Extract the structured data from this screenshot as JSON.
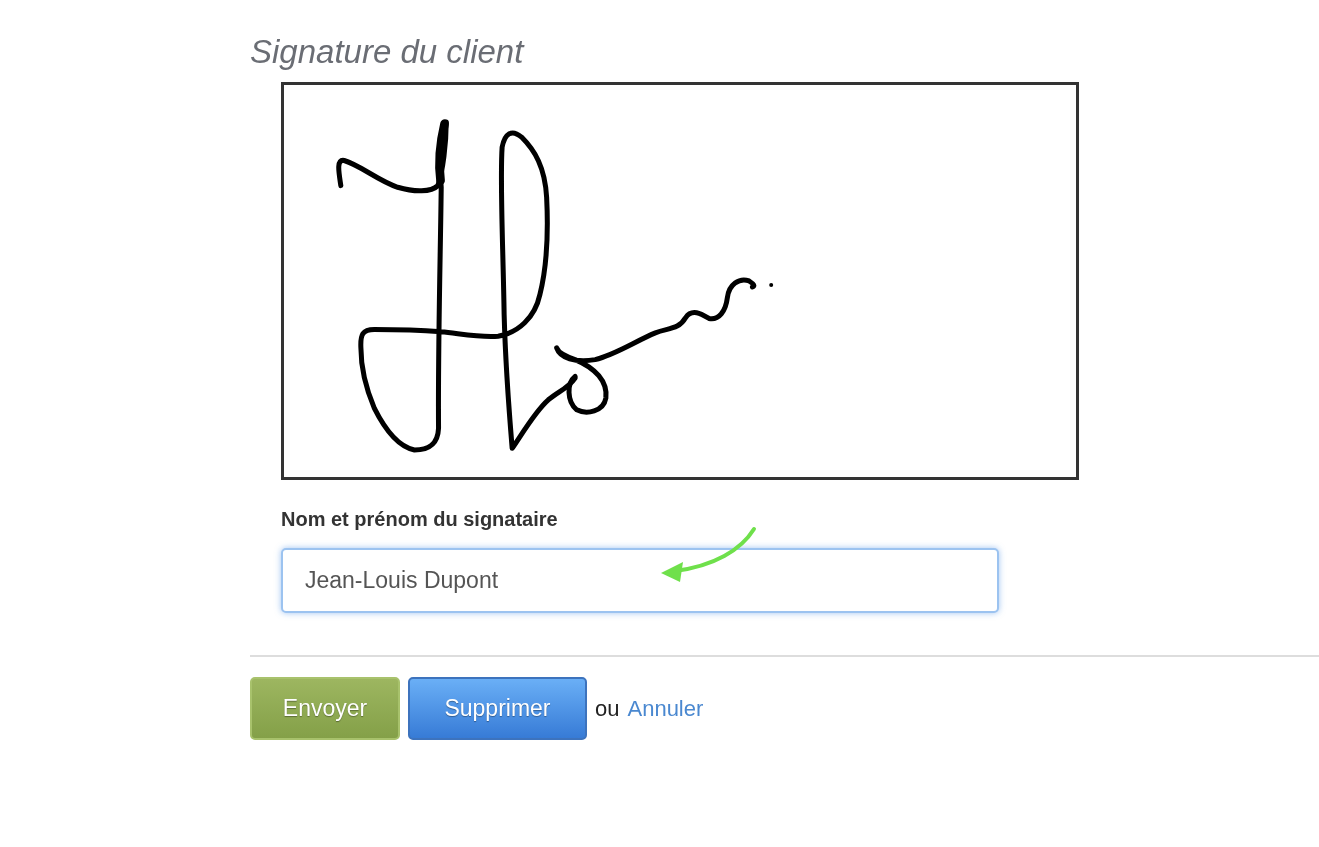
{
  "section": {
    "title": "Signature du client"
  },
  "signature_pad": {
    "signed": true
  },
  "signer_field": {
    "label": "Nom et prénom du signataire",
    "value": "Jean-Louis Dupont",
    "focused": true
  },
  "actions": {
    "buttons": [
      {
        "label": "Envoyer",
        "kind": "success"
      },
      {
        "label": "Supprimer",
        "kind": "primary"
      }
    ],
    "separator_text": "ou",
    "link": "Annuler"
  }
}
